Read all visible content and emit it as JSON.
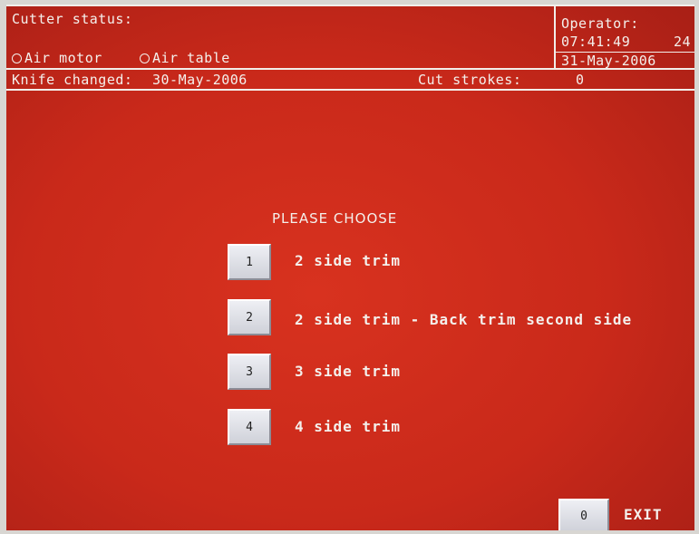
{
  "header": {
    "cutter_status_label": "Cutter status:",
    "air_motor_label": "Air motor",
    "air_table_label": "Air table",
    "operator_label": "Operator:",
    "time": "07:41:49",
    "time_suffix": "24",
    "date": "31-May-2006"
  },
  "status_bar": {
    "knife_changed_label": "Knife changed:",
    "knife_changed_date": "30-May-2006",
    "cut_strokes_label": "Cut strokes:",
    "cut_strokes_value": "0"
  },
  "menu": {
    "heading": "PLEASE CHOOSE",
    "options": [
      {
        "key": "1",
        "label": "2 side trim"
      },
      {
        "key": "2",
        "label": "2 side trim - Back trim second side"
      },
      {
        "key": "3",
        "label": "3 side trim"
      },
      {
        "key": "4",
        "label": "4 side trim"
      }
    ]
  },
  "exit": {
    "key": "0",
    "label": "EXIT"
  },
  "colors": {
    "screen_background": "#c9291a",
    "text": "#f4f0ec",
    "button_face": "#dfe0e6"
  }
}
